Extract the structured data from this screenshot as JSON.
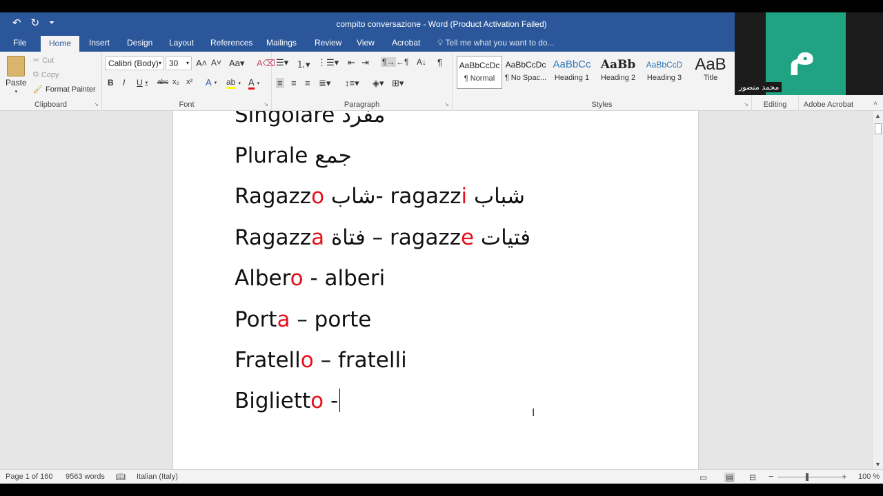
{
  "title_bar": {
    "undo_icon": "undo-icon",
    "redo_icon": "redo-icon",
    "title": "compito conversazione - Word (Product Activation Failed)"
  },
  "tabs": [
    "File",
    "Home",
    "Insert",
    "Design",
    "Layout",
    "References",
    "Mailings",
    "Review",
    "View",
    "Acrobat"
  ],
  "active_tab": "Home",
  "tell_me": "Tell me what you want to do...",
  "clipboard": {
    "paste": "Paste",
    "cut": "Cut",
    "copy": "Copy",
    "format_painter": "Format Painter",
    "label": "Clipboard"
  },
  "font": {
    "family": "Calibri (Body)",
    "size": "30",
    "label": "Font"
  },
  "paragraph": {
    "label": "Paragraph"
  },
  "styles": {
    "label": "Styles",
    "items": [
      {
        "preview": "AaBbCcDc",
        "name": "¶ Normal"
      },
      {
        "preview": "AaBbCcDc",
        "name": "¶ No Spac..."
      },
      {
        "preview": "AaBbCc",
        "name": "Heading 1"
      },
      {
        "preview": "AaBb",
        "name": "Heading 2"
      },
      {
        "preview": "AaBbCcD",
        "name": "Heading 3"
      },
      {
        "preview": "AaB",
        "name": "Title"
      }
    ]
  },
  "editing": {
    "label": "Editing"
  },
  "adobe": {
    "label": "Adobe Acrobat"
  },
  "document": {
    "lines": [
      {
        "parts": [
          {
            "t": "Singolare مفرد",
            "red": false
          }
        ]
      },
      {
        "parts": [
          {
            "t": "Plurale جمع",
            "red": false
          }
        ]
      },
      {
        "parts": [
          {
            "t": "Ragazz",
            "red": false
          },
          {
            "t": "o",
            "red": true
          },
          {
            "t": " شاب- ragazz",
            "red": false
          },
          {
            "t": "i",
            "red": true
          },
          {
            "t": " شباب",
            "red": false
          }
        ]
      },
      {
        "parts": [
          {
            "t": "Ragazz",
            "red": false
          },
          {
            "t": "a",
            "red": true
          },
          {
            "t": " فتاة – ragazz",
            "red": false
          },
          {
            "t": "e",
            "red": true
          },
          {
            "t": " فتيات",
            "red": false
          }
        ]
      },
      {
        "parts": [
          {
            "t": "Alber",
            "red": false
          },
          {
            "t": "o",
            "red": true
          },
          {
            "t": " - alberi",
            "red": false
          }
        ]
      },
      {
        "parts": [
          {
            "t": "Port",
            "red": false
          },
          {
            "t": "a",
            "red": true
          },
          {
            "t": " – porte",
            "red": false
          }
        ]
      },
      {
        "parts": [
          {
            "t": "Fratell",
            "red": false
          },
          {
            "t": "o",
            "red": true
          },
          {
            "t": " – fratelli",
            "red": false
          }
        ]
      },
      {
        "parts": [
          {
            "t": "Bigliett",
            "red": false
          },
          {
            "t": "o",
            "red": true
          },
          {
            "t": " -",
            "red": false
          }
        ]
      }
    ]
  },
  "status": {
    "page": "Page 1 of 160",
    "words": "9563 words",
    "language": "Italian (Italy)",
    "zoom": "100 %"
  },
  "video": {
    "participant_name": "محمد منصور",
    "logo": "ﻡ"
  },
  "colors": {
    "ribbon_blue": "#2b579a",
    "highlight_red": "#e8101a",
    "video_green": "#1fa383"
  }
}
